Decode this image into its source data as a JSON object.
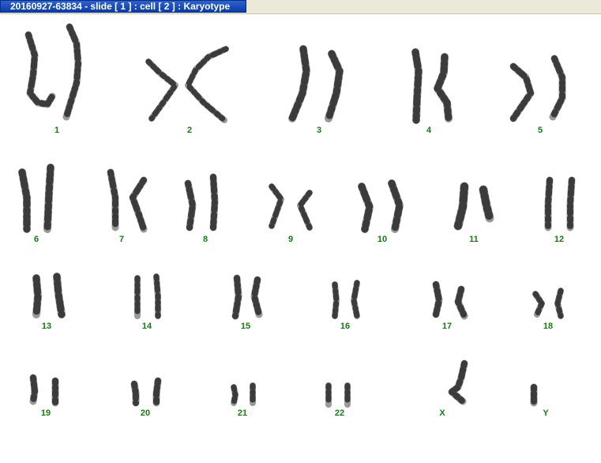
{
  "window": {
    "title": "20160927-63834 - slide [ 1 ] : cell [ 2 ] : Karyotype"
  },
  "colors": {
    "label": "#108010",
    "background": "#ffffff",
    "title_bg": "#1247b8",
    "chromosome_dark": "#2a2a2a",
    "chromosome_light": "#9a9a9a"
  },
  "karyotype": {
    "labels": [
      "1",
      "2",
      "3",
      "4",
      "5",
      "6",
      "7",
      "8",
      "9",
      "10",
      "11",
      "12",
      "13",
      "14",
      "15",
      "16",
      "17",
      "18",
      "19",
      "20",
      "21",
      "22",
      "X",
      "Y"
    ]
  }
}
